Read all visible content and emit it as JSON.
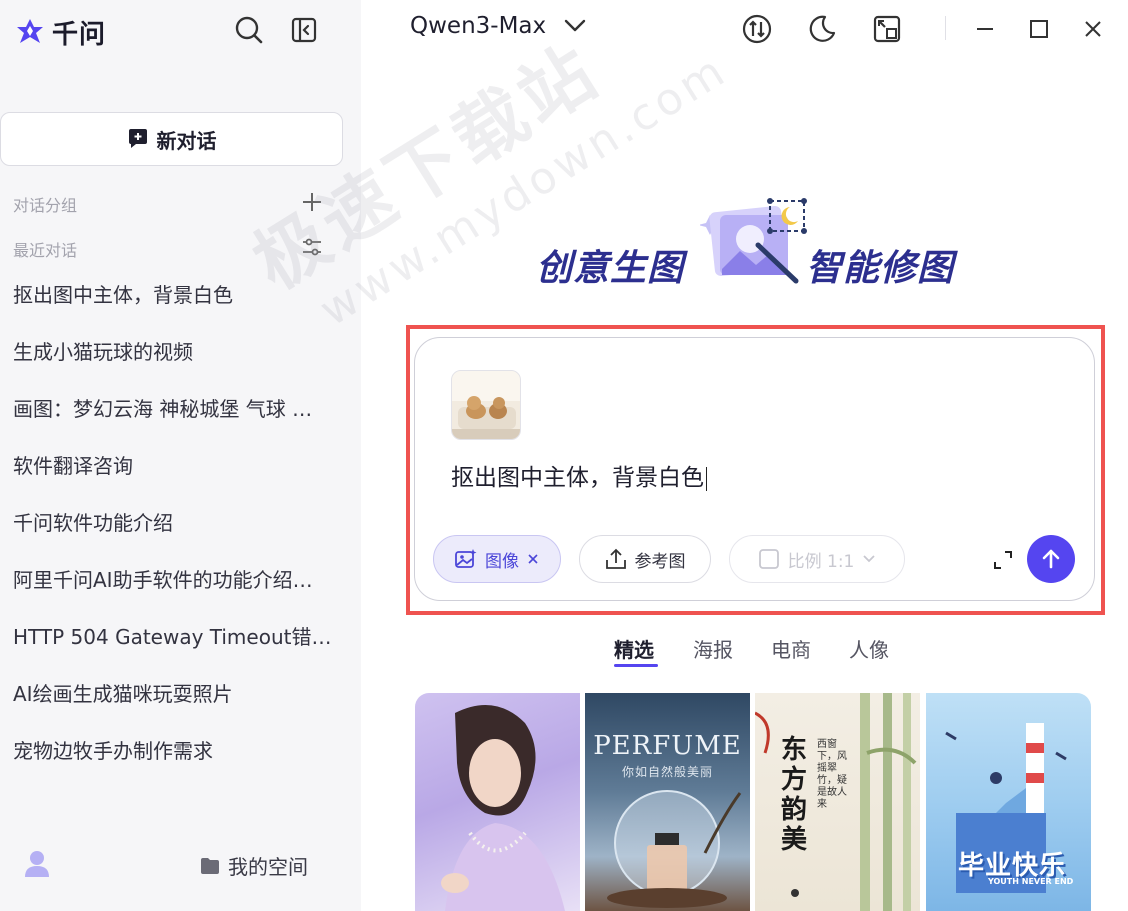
{
  "app": {
    "logo_text": "千问",
    "model_name": "Qwen3-Max"
  },
  "sidebar": {
    "new_chat_label": "新对话",
    "groups_label": "对话分组",
    "recent_label": "最近对话",
    "history": [
      "抠出图中主体，背景白色",
      "生成小猫玩球的视频",
      "画图：梦幻云海 神秘城堡 气球 …",
      "软件翻译咨询",
      "千问软件功能介绍",
      "阿里千问AI助手软件的功能介绍…",
      "HTTP 504 Gateway Timeout错…",
      "AI绘画生成猫咪玩耍照片",
      "宠物边牧手办制作需求"
    ],
    "my_space_label": "我的空间"
  },
  "watermark": {
    "line1": "极速下载站",
    "line2": "www.mydown.com"
  },
  "banner": {
    "left_text": "创意生图",
    "right_text": "智能修图"
  },
  "composer": {
    "prompt_text": "抠出图中主体，背景白色",
    "image_chip_label": "图像",
    "reference_label": "参考图",
    "ratio_label": "比例 1:1"
  },
  "tabs": [
    "精选",
    "海报",
    "电商",
    "人像"
  ],
  "gallery": {
    "perfume_title": "PERFUME",
    "perfume_subtitle": "你如自然般美丽",
    "poster3_title": "东方韵美",
    "poster3_text": "西窗下，风摇翠竹，疑是故人来",
    "poster4_title": "毕业快乐",
    "poster4_subtitle": "YOUTH NEVER END"
  },
  "colors": {
    "accent": "#5545f0",
    "highlight_frame": "#ef5350",
    "sidebar_bg": "#f6f6f8",
    "banner_text": "#2c2f8f"
  }
}
